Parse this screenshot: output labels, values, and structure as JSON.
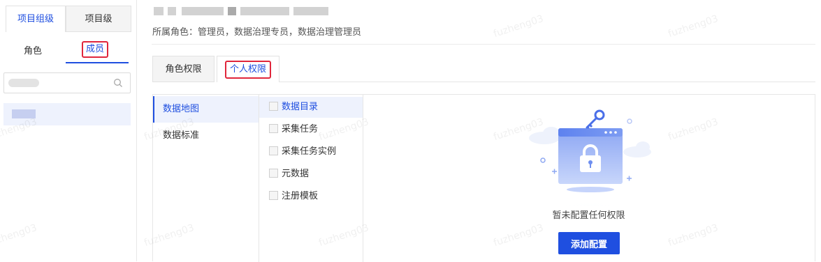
{
  "left_panel": {
    "top_tabs": {
      "active": "项目组级",
      "inactive": "项目级"
    },
    "sub_tabs": {
      "role": "角色",
      "member": "成员"
    },
    "search": {
      "placeholder": ""
    }
  },
  "header": {
    "roles_label": "所属角色：管理员，数据治理专员，数据治理管理员"
  },
  "perm_tabs": {
    "role_perm": "角色权限",
    "personal_perm": "个人权限"
  },
  "categories": [
    "数据地图",
    "数据标准"
  ],
  "items": [
    "数据目录",
    "采集任务",
    "采集任务实例",
    "元数据",
    "注册模板"
  ],
  "empty_state": {
    "message": "暂未配置任何权限",
    "button": "添加配置"
  },
  "watermark": "fuzheng03",
  "colors": {
    "accent": "#1f4fe0",
    "highlight_box": "#e0263b",
    "selected_bg": "#eef2fd"
  }
}
